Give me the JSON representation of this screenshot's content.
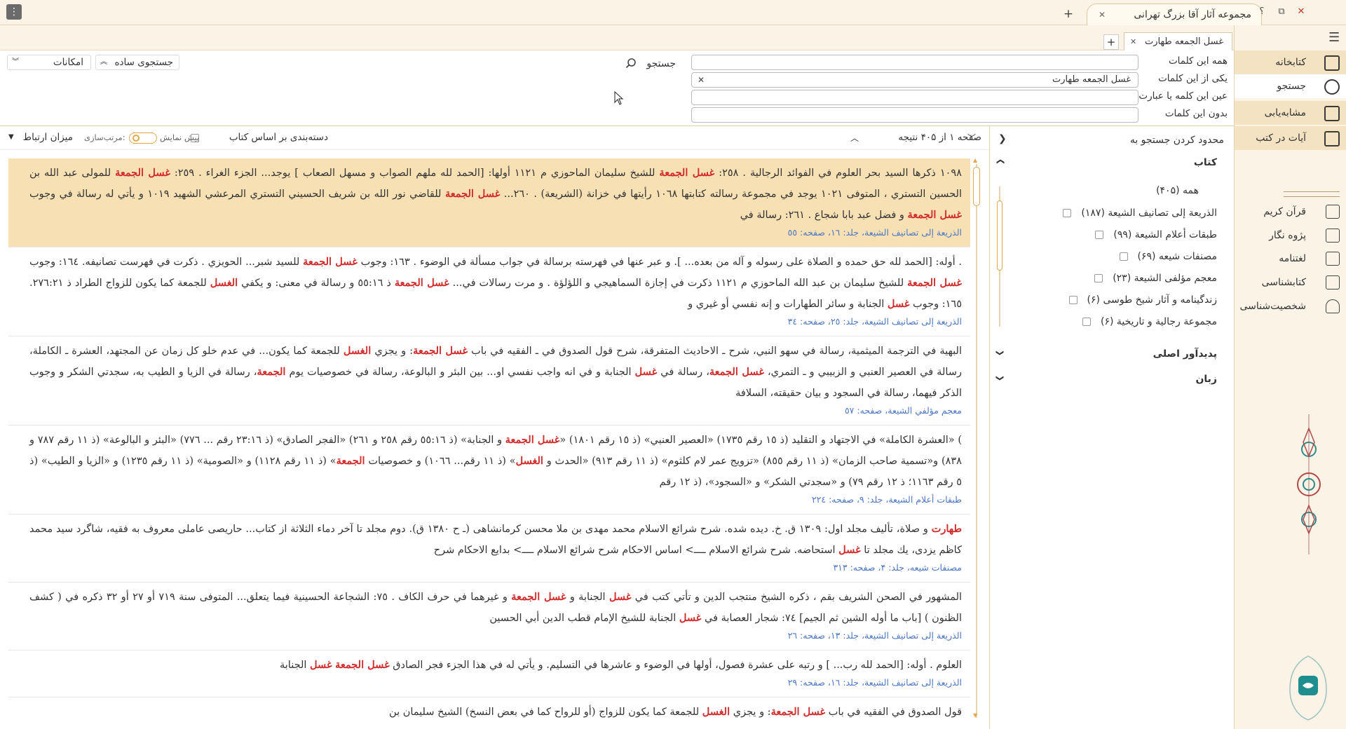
{
  "app": {
    "title": "مجموعه آثار آقا بزرگ تهرانی",
    "tab_close": "✕",
    "tab_add": "+",
    "help": "؟",
    "restore": "⧉",
    "close": "✕",
    "menu_icon": "⋮"
  },
  "doc_tabs": [
    {
      "label": "غسل الجمعه طهارت",
      "close": "✕"
    }
  ],
  "doc_tab_add": "+",
  "sidebar": {
    "items": [
      {
        "label": "کتابخانه",
        "icon": "library-icon"
      },
      {
        "label": "جستجو",
        "icon": "search-icon"
      },
      {
        "label": "مشابه‌یابی",
        "icon": "similar-icon"
      },
      {
        "label": "آیات در کتب",
        "icon": "verses-icon"
      }
    ],
    "sub": [
      {
        "label": "قرآن کریم",
        "icon": "quran-icon"
      },
      {
        "label": "پژوه نگار",
        "icon": "notes-icon"
      },
      {
        "label": "لغتنامه",
        "icon": "dictionary-icon"
      },
      {
        "label": "کتابشناسی",
        "icon": "bibliography-icon"
      },
      {
        "label": "شخصیت‌شناسی",
        "icon": "person-icon"
      }
    ]
  },
  "search": {
    "labels": [
      "همه این کلمات",
      "یکی از این کلمات",
      "عین این کلمه یا عبارت",
      "بدون این کلمات"
    ],
    "values": [
      "",
      "غسل الجمعه طهارت",
      "",
      ""
    ],
    "clear": "✕",
    "search_button": "جستجو",
    "simple_search": "جستجوی ساده",
    "options": "امکانات",
    "chev_up": "︽",
    "chev_down": "︾"
  },
  "filters": {
    "title": "محدود کردن جستجو به",
    "collapse": "❯",
    "book_heading": "کتاب",
    "all": "همه (۴۰۵)",
    "books": [
      "الذریعة إلی تصانیف الشیعة (۱۸۷)",
      "طبقات أعلام الشیعة (۹۹)",
      "مصنفات شیعه (۶۹)",
      "معجم مؤلفی الشیعة (۲۳)",
      "زندگینامه و آثار شیخ طوسی (۶)",
      "مجموعة رجالیة و تاریخیة (۶)"
    ],
    "author_heading": "پدیدآور اصلی",
    "language_heading": "زبان",
    "chev": "❯"
  },
  "results_bar": {
    "page_info": "صفحه ۱ از ۴۰۵ نتیجه",
    "group_by_book": "دسته‌بندی بر اساس کتاب",
    "preview": "پیش نمایش",
    "sort_label": "مرتب‌سازی:",
    "sort_value": "میزان ارتباط",
    "up": "︿",
    "down": "﹀"
  },
  "results": [
    {
      "highlighted": true,
      "parts": [
        {
          "t": "١٠٩٨ ذكرها السيد بحر العلوم في الفوائد الرجالية . ٢٥٨: "
        },
        {
          "t": "غسل الجمعة",
          "m": true
        },
        {
          "t": " للشيخ سليمان الماحوزي م ١١٢١ أولها: [الحمد لله ملهم الصواب و مسهل الصعاب ] يوجد... الجزء الغراء . ٢٥٩: "
        },
        {
          "t": "غسل الجمعة",
          "m": true
        },
        {
          "t": " للمولى عبد الله بن الحسين التستري ، المتوفى ١٠٢١ يوجد في مجموعة رسالته كتابتها ١٠٦٨ رأيتها في خزانة (الشريعة) . ٢٦٠... "
        },
        {
          "t": "غسل الجمعة",
          "m": true
        },
        {
          "t": " للقاضي نور الله بن شريف الحسيني التستري المرعشي الشهيد ١٠١٩ و يأتي له رسالة في وجوب "
        },
        {
          "t": "غسل الجمعة",
          "m": true
        },
        {
          "t": " و فضل عبد بابا شجاع . ٢٦١: رسالة في"
        }
      ],
      "source": "الذريعة إلى تصانيف الشيعة، جلد: ١٦، صفحه: ٥٥"
    },
    {
      "highlighted": false,
      "parts": [
        {
          "t": ". أوله: [الحمد لله حق حمده و الصلاة على رسوله و آله من بعده... ]. و عبر عنها في فهرسته برسالة في جواب مسألة في الوضوء . ١٦٣: وجوب "
        },
        {
          "t": "غسل الجمعة",
          "m": true
        },
        {
          "t": " للسيد شبر... الحويزي . ذكرت في فهرست تصانيفه. ١٦٤: وجوب "
        },
        {
          "t": "غسل الجمعة",
          "m": true
        },
        {
          "t": " للشيخ سليمان بن عبد الله الماحوزي م ١١٢١ ذكرت في إجازة السماهيجي و اللؤلؤة . و مرت رسالات في... "
        },
        {
          "t": "غسل الجمعة",
          "m": true
        },
        {
          "t": " ذ ٥٥:١٦ و رسالة في معنى: و يكفي "
        },
        {
          "t": "الغسل",
          "m": true
        },
        {
          "t": " للجمعة كما يكون للزواج الطراد ذ ٢٧٦:٢١. ١٦٥: وجوب "
        },
        {
          "t": "غسل",
          "m": true
        },
        {
          "t": " الجنابة و سائر الطهارات و إنه نفسي أو غيري و"
        }
      ],
      "source": "الذريعة إلى تصانيف الشيعة، جلد: ٢٥، صفحه: ٣٤"
    },
    {
      "highlighted": false,
      "parts": [
        {
          "t": "البهية في الترجمة الميثمية، رسالة في سهو النبي، شرح ـ الاحاديث المتفرقة، شرح قول الصدوق في ـ الفقيه في باب "
        },
        {
          "t": "غسل الجمعة",
          "m": true
        },
        {
          "t": ": و يجزي "
        },
        {
          "t": "الغسل",
          "m": true
        },
        {
          "t": " للجمعة كما يكون... في عدم خلو كل زمان عن المجتهد، العشرة ـ الكاملة، رسالة في العصير العنبي و الزبيبي و ـ التمري، "
        },
        {
          "t": "غسل الجمعة",
          "m": true
        },
        {
          "t": "، رسالة في "
        },
        {
          "t": "غسل",
          "m": true
        },
        {
          "t": " الجنابة و في انه واجب نفسي او... بين البئر و البالوعة، رسالة في خصوصيات يوم "
        },
        {
          "t": "الجمعة",
          "m": true
        },
        {
          "t": "، رسالة في الزيا و الطيب به، سجدتي الشكر و وجوب الذكر فيهما، رسالة في السجود و بيان حقيقته، السلافة"
        }
      ],
      "source": "معجم مؤلفي الشيعة، صفحه: ٥٧"
    },
    {
      "highlighted": false,
      "parts": [
        {
          "t": ") «العشرة الكاملة» في الاجتهاد و التقليد (ذ ١٥ رقم ١٧٣٥) «العصير العنبي» (ذ ١٥ رقم ١٨٠١) «"
        },
        {
          "t": "غسل الجمعة",
          "m": true
        },
        {
          "t": " و الجنابة» (ذ ٥٥:١٦ رقم ٢٥٨ و ٢٦١) «الفجر الصادق» (ذ ٢٣:١٦ رقم ... ٧٧٦) «البئر و البالوعة» (ذ ١١ رقم ٧٨٧ و ٨٣٨) و«تسمية صاحب الزمان» (ذ ١١ رقم ٨٥٥) «تزويج عمر لام كلثوم» (ذ ١١ رقم ٩١٣) «الحدث و "
        },
        {
          "t": "الغسل",
          "m": true
        },
        {
          "t": "» (ذ ١١ رقم... ١٠٦٦) و خصوصيات "
        },
        {
          "t": "الجمعة",
          "m": true
        },
        {
          "t": "» (ذ ١١ رقم ١١٢٨) و «الصومية» (ذ ١١ رقم ١٢٣٥) و «الزيا و الطيب» (ذ ٥ رقم ١١٦٣؛ ذ ١٢ رقم ٧٩) و «سجدتي الشكر» و «السجود»، (ذ ١٢ رقم"
        }
      ],
      "source": "طبقات أعلام الشيعة، جلد: ٩، صفحه: ٢٢٤"
    },
    {
      "highlighted": false,
      "parts": [
        {
          "t": "طهارت",
          "m": true
        },
        {
          "t": " و صلاة، تأليف مجلد اول: ١٣٠٩ ق. خ. ديده شده. شرح شرائع الاسلام محمد مهدى بن ملا محسن كرمانشاهى (ـ ح ١٣٨٠ ق). دوم مجلد تا آخر دماء الثلاثة از كتاب... حاريصى عاملى معروف به فقيه، شاگرد سيد محمد كاظم يزدى، يك مجلد تا "
        },
        {
          "t": "غسل",
          "m": true
        },
        {
          "t": " استحاضه. شرح شرائع الاسلام ــــ> اساس الاحكام شرح شرائع الاسلام ــــ> بدايع الاحكام شرح"
        }
      ],
      "source": "مصنفات شيعه، جلد: ۴، صفحه: ٣١٣"
    },
    {
      "highlighted": false,
      "parts": [
        {
          "t": "المشهور في الصحن الشريف بقم ، ذكره الشيخ منتجب الدين و تأتي كتب في "
        },
        {
          "t": "غسل",
          "m": true
        },
        {
          "t": " الجنابة و "
        },
        {
          "t": "غسل الجمعة",
          "m": true
        },
        {
          "t": " و غيرهما في حرف الكاف . ٧٥: الشجاعة الحسينية فيما يتعلق... المتوفى سنة ٧١٩ أو ٢٧ أو ٣٢ ذكره في ( كشف الظنون ) [باب ما أوله الشين ثم الجيم] ٧٤: شجار العصابة في "
        },
        {
          "t": "غسل",
          "m": true
        },
        {
          "t": " الجنابة للشيخ الإمام قطب الدين أبي الحسين"
        }
      ],
      "source": "الذريعة إلى تصانيف الشيعة، جلد: ١٣، صفحه: ٢٦"
    },
    {
      "highlighted": false,
      "parts": [
        {
          "t": "العلوم . أوله: [الحمد لله رب... ] و رتبه على عشرة فصول، أولها في الوضوء و عاشرها في التسليم. و يأتي له في هذا الجزء فجر الصادق "
        },
        {
          "t": "غسل الجمعة",
          "m": true
        },
        {
          "t": " "
        },
        {
          "t": "غسل",
          "m": true
        },
        {
          "t": " الجنابة"
        }
      ],
      "source": "الذريعة إلى تصانيف الشيعة، جلد: ١٦، صفحه: ٢٩"
    },
    {
      "highlighted": false,
      "parts": [
        {
          "t": "قول الصدوق في الفقيه في باب "
        },
        {
          "t": "غسل الجمعة",
          "m": true
        },
        {
          "t": ": و يجزي "
        },
        {
          "t": "الغسل",
          "m": true
        },
        {
          "t": " للجمعة كما يكون للزواج (أو للرواح كما في بعض النسخ) الشيخ سليمان بن"
        }
      ],
      "source": ""
    }
  ]
}
